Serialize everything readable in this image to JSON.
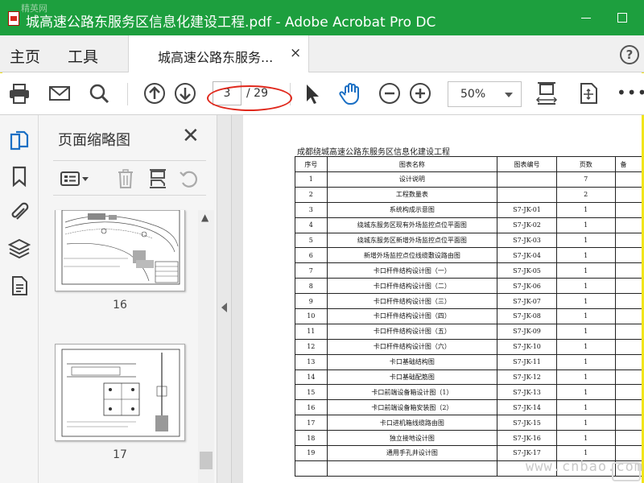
{
  "window": {
    "title": "城高速公路东服务区信息化建设工程.pdf - Adobe Acrobat Pro DC",
    "watermark": "精英网"
  },
  "menu": {
    "home": "主页",
    "tools": "工具",
    "doc_tab": "城高速公路东服务...",
    "doc_tab_close": "×",
    "help": "?"
  },
  "toolbar": {
    "current_page": "3",
    "total_pages": "/ 29",
    "zoom": "50%",
    "more": "•••"
  },
  "thumbnails": {
    "title": "页面缩略图",
    "close": "✕",
    "pages": [
      {
        "number": "16"
      },
      {
        "number": "17"
      }
    ]
  },
  "document": {
    "heading": "成都绕城高速公路东服务区信息化建设工程",
    "columns": [
      "序号",
      "图表名称",
      "图表编号",
      "页数",
      "备"
    ],
    "rows": [
      [
        "1",
        "设计说明",
        "",
        "7"
      ],
      [
        "2",
        "工程数量表",
        "",
        "2"
      ],
      [
        "3",
        "系统构成示意图",
        "S7-JK-01",
        "1"
      ],
      [
        "4",
        "绕城东服务区现有外场监控点位平面图",
        "S7-JK-02",
        "1"
      ],
      [
        "5",
        "绕城东服务区新增外场监控点位平面图",
        "S7-JK-03",
        "1"
      ],
      [
        "6",
        "新增外场监控点位线缆敷设路由图",
        "S7-JK-04",
        "1"
      ],
      [
        "7",
        "卡口杆件结构设计图（一）",
        "S7-JK-05",
        "1"
      ],
      [
        "8",
        "卡口杆件结构设计图（二）",
        "S7-JK-06",
        "1"
      ],
      [
        "9",
        "卡口杆件结构设计图（三）",
        "S7-JK-07",
        "1"
      ],
      [
        "10",
        "卡口杆件结构设计图（四）",
        "S7-JK-08",
        "1"
      ],
      [
        "11",
        "卡口杆件结构设计图（五）",
        "S7-JK-09",
        "1"
      ],
      [
        "12",
        "卡口杆件结构设计图（六）",
        "S7-JK-10",
        "1"
      ],
      [
        "13",
        "卡口基础结构图",
        "S7-JK-11",
        "1"
      ],
      [
        "14",
        "卡口基础配筋图",
        "S7-JK-12",
        "1"
      ],
      [
        "15",
        "卡口前端设备箱设计图（1）",
        "S7-JK-13",
        "1"
      ],
      [
        "16",
        "卡口前端设备箱安装图（2）",
        "S7-JK-14",
        "1"
      ],
      [
        "17",
        "卡口进机箱线缆路由图",
        "S7-JK-15",
        "1"
      ],
      [
        "18",
        "独立接地设计图",
        "S7-JK-16",
        "1"
      ],
      [
        "19",
        "通用手孔井设计图",
        "S7-JK-17",
        "1"
      ],
      [
        "",
        "",
        "",
        ""
      ]
    ]
  },
  "footer_watermark": "www.cnbao.com",
  "colors": {
    "titlebar": "#1d9f3e",
    "frame": "#f2e51b",
    "annotation": "#e0281c"
  }
}
